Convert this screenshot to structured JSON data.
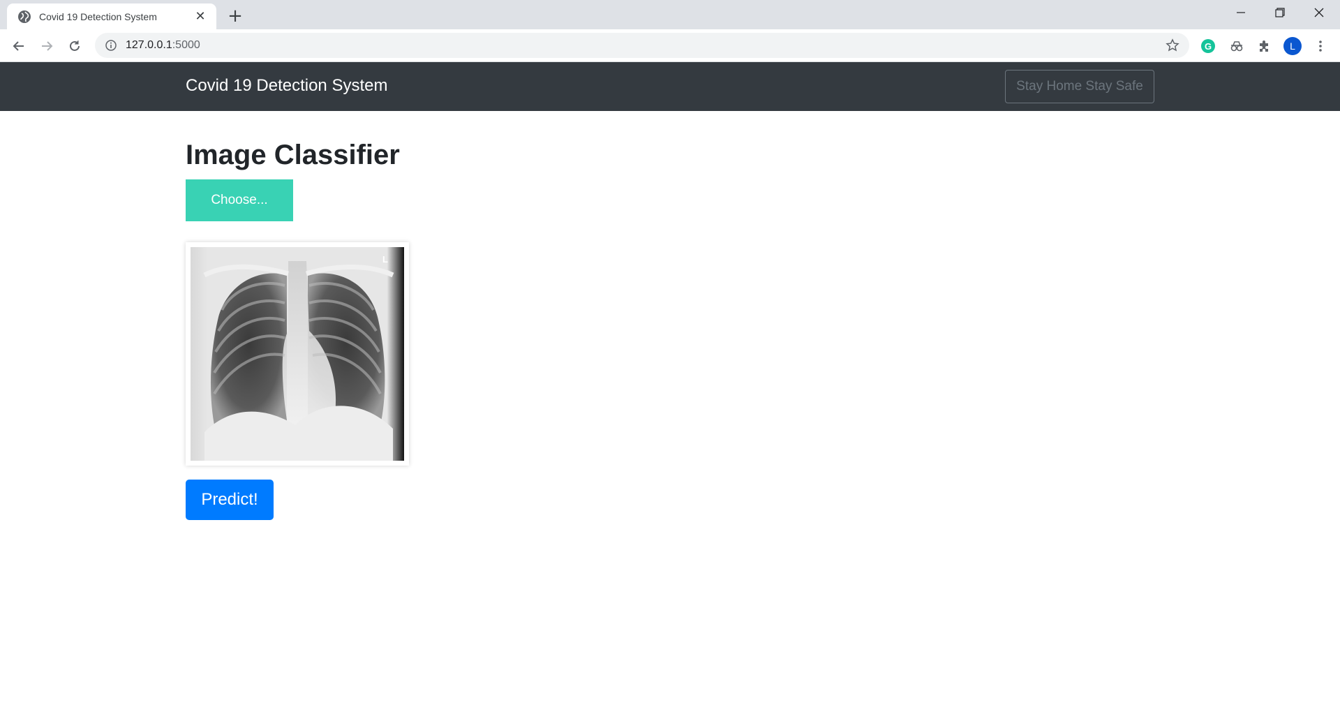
{
  "browser": {
    "tab_title": "Covid 19 Detection System",
    "url_host": "127.0.0.1",
    "url_port": ":5000",
    "profile_initial": "L",
    "grammarly_letter": "G"
  },
  "navbar": {
    "brand": "Covid 19 Detection System",
    "stay_label": "Stay Home Stay Safe"
  },
  "main": {
    "title": "Image Classifier",
    "choose_label": "Choose...",
    "predict_label": "Predict!",
    "xray_marker": "L"
  },
  "colors": {
    "navbar_bg": "#343a40",
    "choose_bg": "#39d2b4",
    "predict_bg": "#007bff"
  }
}
